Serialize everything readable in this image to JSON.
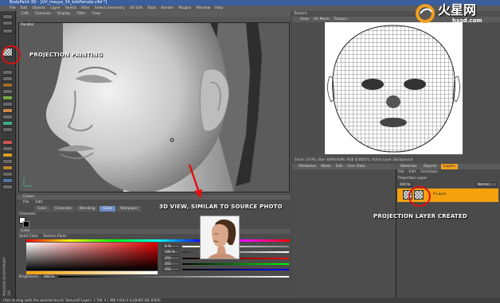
{
  "window": {
    "title": "BodyPaint 3D - [UV_mayya_34_bdsFemale.c4d *]"
  },
  "menubar": [
    "File",
    "Edit",
    "Objects",
    "Layer",
    "Select",
    "Filter",
    "Select Geometry",
    "UV Edit",
    "Tools",
    "Render",
    "Plugins",
    "Window",
    "Help"
  ],
  "viewport": {
    "menu": [
      "Edit",
      "Cameras",
      "Display",
      "Filter",
      "View"
    ],
    "camera_label": "Parallel"
  },
  "texture_view": {
    "title": "Texture",
    "menu": [
      "View",
      "UV Mesh",
      "Texture"
    ],
    "status": "Zoom: 10.9%, Size: 4096x4096, RGB (8 Bit/Ch), Active Layer: Background"
  },
  "attributes": {
    "title": "Attributes",
    "menu": [
      "Mode",
      "Edit",
      "User Data"
    ]
  },
  "objects_panel": {
    "tabs": [
      "Materials",
      "Objects",
      "Layers"
    ],
    "active_tab": "Layers",
    "submenu": [
      "File",
      "Edit",
      "Functions"
    ],
    "projection_label": "Projection Layer",
    "opacity": "100 %",
    "blend_mode": "Normal",
    "layer_name": "P Layer"
  },
  "colors_panel": {
    "title": "Colors",
    "menu": [
      "File",
      "Edit"
    ],
    "tabs": [
      "Color",
      "Channels",
      "Blending",
      "Color",
      "Wallpaper"
    ],
    "active_tab": "Color",
    "channels_label": "Channels",
    "color_label": "Color",
    "sub_tabs": [
      "Solid Color",
      "Texture Paint"
    ],
    "values": [
      "0 %",
      "100 %",
      "255",
      "255",
      "255"
    ],
    "brightness_label": "Brightness",
    "brightness_value": "100 %"
  },
  "statusbar": {
    "text": "Click to drag (with the selected brush) Texture(P Layer): 1°3/8: X / 388 Ycl(b) E (L)(B:B/C:B/L:0/0/0)"
  },
  "annotations": {
    "projection_painting": "PROJECTION PAINTING",
    "view_3d": "3D VIEW, SIMILAR TO SOURCE PHOTO",
    "layer_created": "PROJECTION LAYER CREATED",
    "side_logo": "MAXON BODYPAINT 3D",
    "annotation_color": "#e01010"
  },
  "watermark": {
    "title": "火星网",
    "url": "hxsd.com"
  }
}
